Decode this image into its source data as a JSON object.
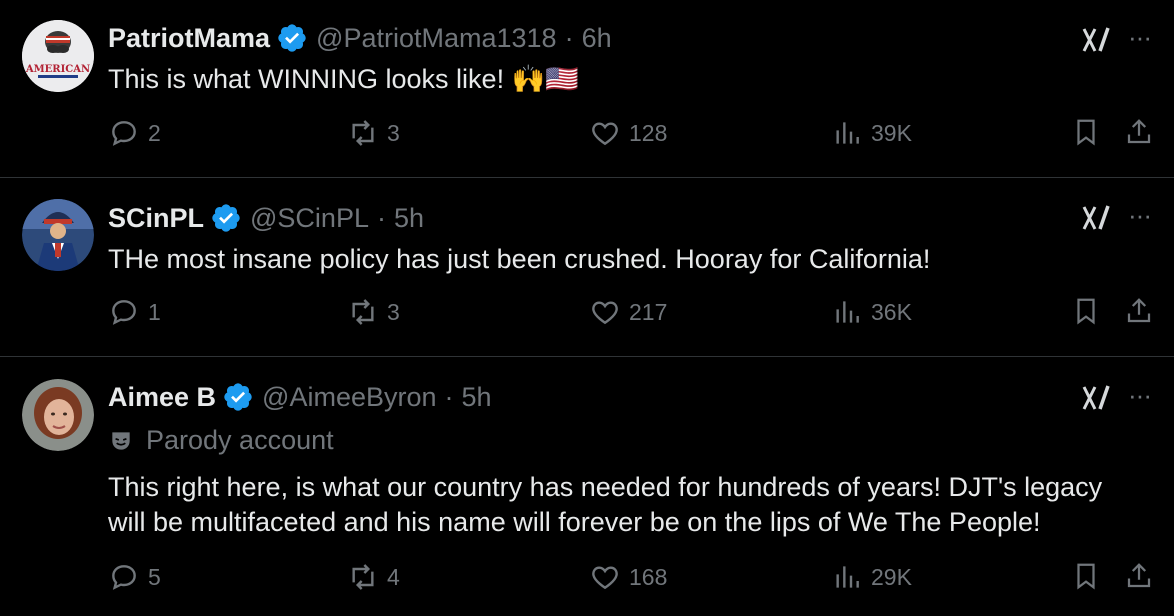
{
  "colors": {
    "background": "#000000",
    "text": "#e7e9ea",
    "muted": "#71767b",
    "verified": "#1d9bf0",
    "divider": "#2f3336"
  },
  "tweets": [
    {
      "name": "PatriotMama",
      "handle": "@PatriotMama1318",
      "separator": "·",
      "time": "6h",
      "text_lines": [
        "This is what WINNING looks like! 🙌🇺🇸"
      ],
      "avatar_text": "AMERICAN",
      "replies": "2",
      "reposts": "3",
      "likes": "128",
      "views": "39K"
    },
    {
      "name": "SCinPL",
      "handle": "@SCinPL",
      "separator": "·",
      "time": "5h",
      "text_lines": [
        "THe most insane policy has just been crushed. Hooray for California!"
      ],
      "replies": "1",
      "reposts": "3",
      "likes": "217",
      "views": "36K"
    },
    {
      "name": "Aimee B",
      "handle": "@AimeeByron",
      "separator": "·",
      "time": "5h",
      "parody_label": "Parody account",
      "text_lines": [
        "This right here, is what our country has needed for hundreds of years! DJT's legacy",
        "will be multifaceted and his name will forever be on the lips of We The People!"
      ],
      "replies": "5",
      "reposts": "4",
      "likes": "168",
      "views": "29K"
    }
  ],
  "icons": {
    "verified": "verified-badge-icon",
    "grok": "grok-icon",
    "more": "more-options-icon",
    "reply": "reply-icon",
    "repost": "repost-icon",
    "like": "like-icon",
    "views": "views-icon",
    "bookmark": "bookmark-icon",
    "share": "share-icon",
    "parody": "parody-mask-icon"
  },
  "more_glyph": "···"
}
